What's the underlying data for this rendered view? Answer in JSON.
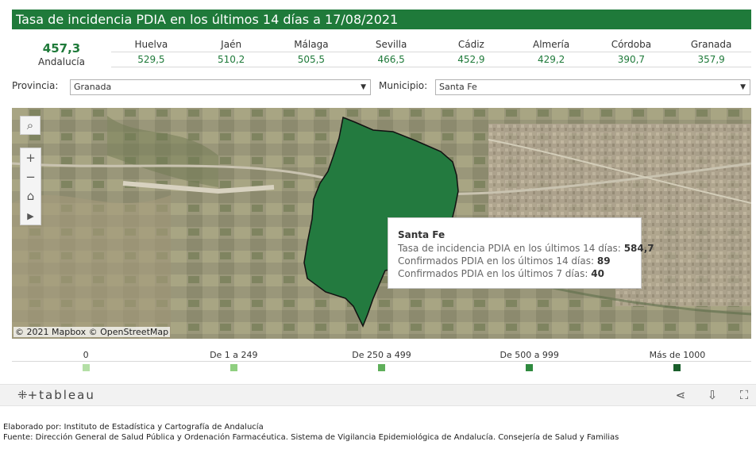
{
  "title": "Tasa de incidencia PDIA en los últimos 14 días a 17/08/2021",
  "summary": {
    "value": "457,3",
    "label": "Andalucía"
  },
  "provinces": [
    {
      "name": "Huelva",
      "value": "529,5"
    },
    {
      "name": "Jaén",
      "value": "510,2"
    },
    {
      "name": "Málaga",
      "value": "505,5"
    },
    {
      "name": "Sevilla",
      "value": "466,5"
    },
    {
      "name": "Cádiz",
      "value": "452,9"
    },
    {
      "name": "Almería",
      "value": "429,2"
    },
    {
      "name": "Córdoba",
      "value": "390,7"
    },
    {
      "name": "Granada",
      "value": "357,9"
    }
  ],
  "filters": {
    "provincia": {
      "label": "Provincia:",
      "value": "Granada"
    },
    "municipio": {
      "label": "Municipio:",
      "value": "Santa Fe"
    }
  },
  "map": {
    "attribution": "© 2021 Mapbox  © OpenStreetMap",
    "highlight_color": "#237a3f",
    "tools": {
      "search": "search-icon",
      "zoom_in": "plus-icon",
      "zoom_out": "minus-icon",
      "home": "home-icon",
      "play": "play-icon"
    }
  },
  "tooltip": {
    "name": "Santa Fe",
    "rows": [
      {
        "label": "Tasa de incidencia PDIA en los últimos 14 días:",
        "value": "584,7"
      },
      {
        "label": "Confirmados PDIA en los últimos 14 días:",
        "value": "89"
      },
      {
        "label": "Confirmados PDIA en los últimos 7 días:",
        "value": "40"
      }
    ]
  },
  "legend": [
    {
      "label": "0",
      "color": "#b4dfa6"
    },
    {
      "label": "De 1 a 249",
      "color": "#8fcf80"
    },
    {
      "label": "De 250 a 499",
      "color": "#5faf5a"
    },
    {
      "label": "De 500 a 999",
      "color": "#2f8a3f"
    },
    {
      "label": "Más de 1000",
      "color": "#1a5f2c"
    }
  ],
  "tableau": {
    "logo": "tableau",
    "icons": [
      "share-icon",
      "download-icon",
      "fullscreen-icon"
    ]
  },
  "footer": {
    "line1": "Elaborado por: Instituto de Estadística y Cartografía de Andalucía",
    "line2": "Fuente: Dirección General de Salud Pública y Ordenación Farmacéutica. Sistema de Vigilancia Epidemiológica de Andalucía. Consejería de Salud y Familias"
  }
}
